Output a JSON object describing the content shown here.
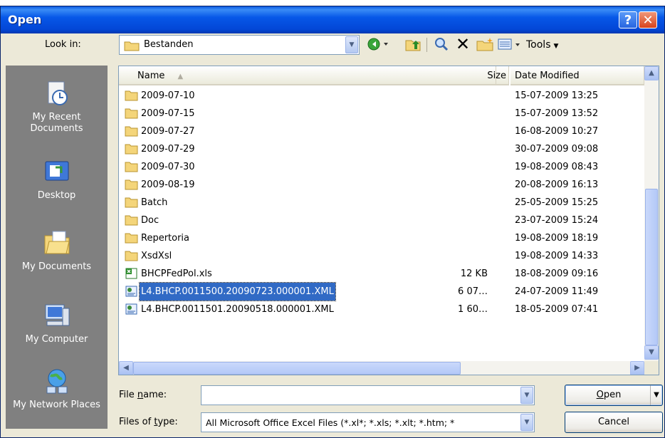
{
  "window": {
    "title": "Open"
  },
  "look_in": {
    "label": "Look in:",
    "value": "Bestanden"
  },
  "toolbar": {
    "tools_label": "Tools"
  },
  "places": [
    {
      "label": "My Recent Documents",
      "icon": "recent-documents-icon"
    },
    {
      "label": "Desktop",
      "icon": "desktop-icon"
    },
    {
      "label": "My Documents",
      "icon": "my-documents-icon"
    },
    {
      "label": "My Computer",
      "icon": "my-computer-icon"
    },
    {
      "label": "My Network Places",
      "icon": "network-places-icon"
    }
  ],
  "columns": {
    "name": "Name",
    "size": "Size",
    "date": "Date Modified"
  },
  "files": [
    {
      "name": "2009-07-10",
      "size": "",
      "date": "15-07-2009 13:25",
      "type": "folder",
      "selected": false
    },
    {
      "name": "2009-07-15",
      "size": "",
      "date": "15-07-2009 13:52",
      "type": "folder",
      "selected": false
    },
    {
      "name": "2009-07-27",
      "size": "",
      "date": "16-08-2009 10:27",
      "type": "folder",
      "selected": false
    },
    {
      "name": "2009-07-29",
      "size": "",
      "date": "30-07-2009 09:08",
      "type": "folder",
      "selected": false
    },
    {
      "name": "2009-07-30",
      "size": "",
      "date": "19-08-2009 08:43",
      "type": "folder",
      "selected": false
    },
    {
      "name": "2009-08-19",
      "size": "",
      "date": "20-08-2009 16:13",
      "type": "folder",
      "selected": false
    },
    {
      "name": "Batch",
      "size": "",
      "date": "25-05-2009 15:25",
      "type": "folder",
      "selected": false
    },
    {
      "name": "Doc",
      "size": "",
      "date": "23-07-2009 15:24",
      "type": "folder",
      "selected": false
    },
    {
      "name": "Repertoria",
      "size": "",
      "date": "19-08-2009 18:19",
      "type": "folder",
      "selected": false
    },
    {
      "name": "XsdXsl",
      "size": "",
      "date": "19-08-2009 14:33",
      "type": "folder",
      "selected": false
    },
    {
      "name": "BHCPFedPol.xls",
      "size": "12 KB",
      "date": "18-08-2009 09:16",
      "type": "excel",
      "selected": false
    },
    {
      "name": "L4.BHCP.0011500.20090723.000001.XML",
      "size": "6 07…",
      "date": "24-07-2009 11:49",
      "type": "xml",
      "selected": true
    },
    {
      "name": "L4.BHCP.0011501.20090518.000001.XML",
      "size": "1 60…",
      "date": "18-05-2009 07:41",
      "type": "xml",
      "selected": false
    }
  ],
  "file_name": {
    "label_pre": "File ",
    "label_u": "n",
    "label_post": "ame:",
    "value": ""
  },
  "file_type": {
    "label_pre": "Files of ",
    "label_u": "t",
    "label_post": "ype:",
    "value": "All Microsoft Office Excel Files (*.xl*; *.xls; *.xlt; *.htm; *"
  },
  "buttons": {
    "open_u": "O",
    "open_rest": "pen",
    "cancel": "Cancel"
  },
  "colors": {
    "selection": "#316ac5",
    "titlebar": "#0758e8",
    "places_bg": "#808080"
  }
}
